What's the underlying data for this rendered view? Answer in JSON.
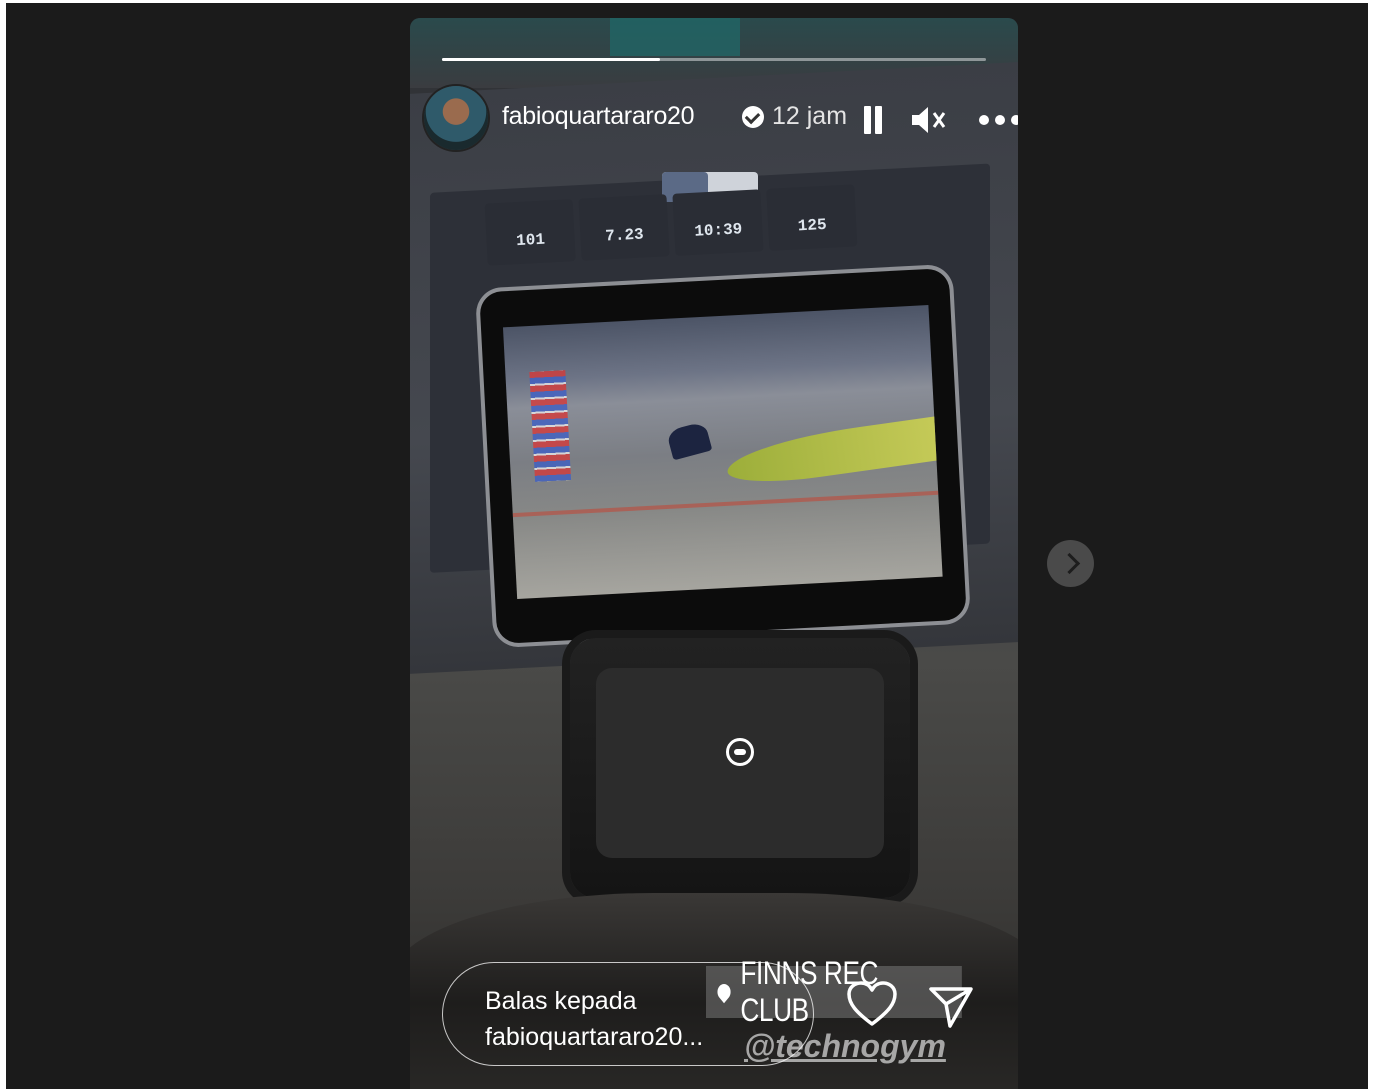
{
  "story": {
    "username": "fabioquartararo20",
    "verified": true,
    "time_ago": "12 jam",
    "progress": 0.4,
    "console_stats": [
      "101",
      "7.23",
      "10:39",
      "125"
    ],
    "location": "FINNS REC CLUB",
    "mention": "@technogym",
    "reply_placeholder_line1": "Balas kepada",
    "reply_placeholder_line2": "fabioquartararo20...",
    "icons": {
      "pause": "pause-icon",
      "mute": "speaker-muted-icon",
      "more": "more-horizontal-icon",
      "like": "heart-icon",
      "share": "send-icon",
      "next": "chevron-right-icon",
      "location": "location-pin-icon"
    }
  },
  "colors": {
    "page_background": "#1b1b1b",
    "next_button": "#4a4a4a"
  }
}
